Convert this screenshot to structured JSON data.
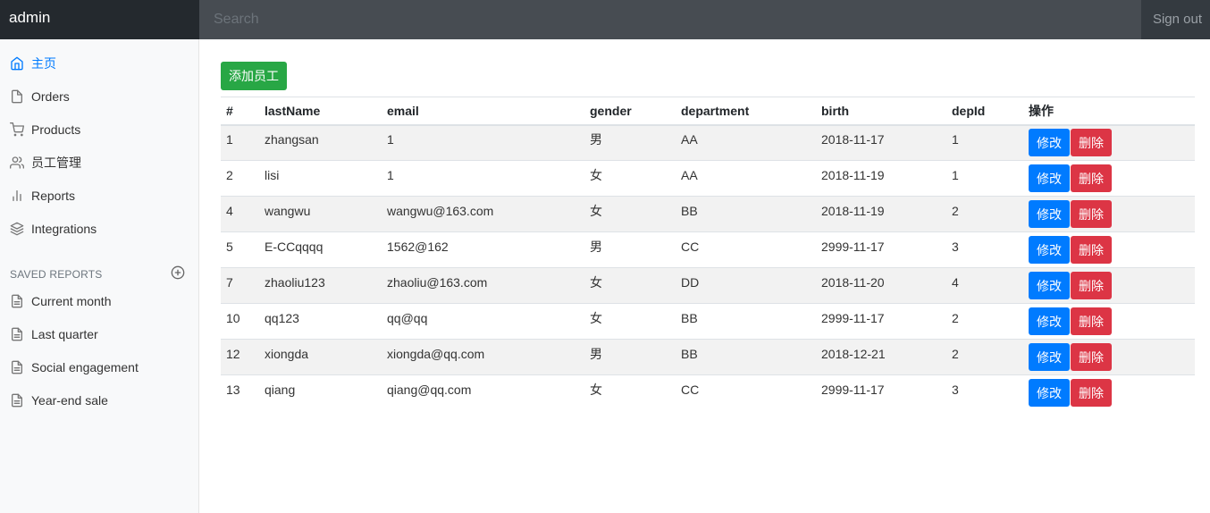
{
  "navbar": {
    "brand": "admin",
    "search_placeholder": "Search",
    "signout": "Sign out"
  },
  "sidebar": {
    "items": [
      {
        "label": "主页",
        "icon": "home-icon",
        "active": true
      },
      {
        "label": "Orders",
        "icon": "file-icon"
      },
      {
        "label": "Products",
        "icon": "shopping-cart-icon"
      },
      {
        "label": "员工管理",
        "icon": "users-icon"
      },
      {
        "label": "Reports",
        "icon": "bar-chart-icon"
      },
      {
        "label": "Integrations",
        "icon": "layers-icon"
      }
    ],
    "saved_heading": "SAVED REPORTS",
    "saved_items": [
      {
        "label": "Current month",
        "icon": "file-text-icon"
      },
      {
        "label": "Last quarter",
        "icon": "file-text-icon"
      },
      {
        "label": "Social engagement",
        "icon": "file-text-icon"
      },
      {
        "label": "Year-end sale",
        "icon": "file-text-icon"
      }
    ]
  },
  "main": {
    "add_button": "添加员工",
    "table": {
      "headers": [
        "#",
        "lastName",
        "email",
        "gender",
        "department",
        "birth",
        "depId",
        "操作"
      ],
      "rows": [
        [
          "1",
          "zhangsan",
          "1",
          "男",
          "AA",
          "2018-11-17",
          "1"
        ],
        [
          "2",
          "lisi",
          "1",
          "女",
          "AA",
          "2018-11-19",
          "1"
        ],
        [
          "4",
          "wangwu",
          "wangwu@163.com",
          "女",
          "BB",
          "2018-11-19",
          "2"
        ],
        [
          "5",
          "E-CCqqqq",
          "1562@162",
          "男",
          "CC",
          "2999-11-17",
          "3"
        ],
        [
          "7",
          "zhaoliu123",
          "zhaoliu@163.com",
          "女",
          "DD",
          "2018-11-20",
          "4"
        ],
        [
          "10",
          "qq123",
          "qq@qq",
          "女",
          "BB",
          "2999-11-17",
          "2"
        ],
        [
          "12",
          "xiongda",
          "xiongda@qq.com",
          "男",
          "BB",
          "2018-12-21",
          "2"
        ],
        [
          "13",
          "qiang",
          "qiang@qq.com",
          "女",
          "CC",
          "2999-11-17",
          "3"
        ]
      ],
      "edit_label": "修改",
      "delete_label": "删除"
    }
  },
  "colors": {
    "active": "#007bff",
    "success": "#28a745",
    "danger": "#dc3545",
    "navbar": "#343a40"
  }
}
